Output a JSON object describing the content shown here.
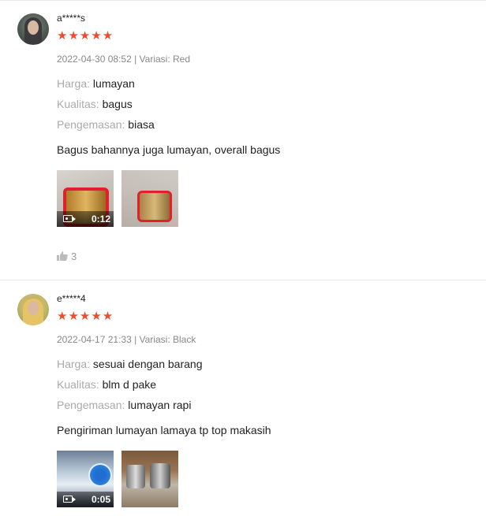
{
  "reviews": [
    {
      "username": "a*****s",
      "stars": "★★★★★",
      "rating": 5,
      "meta": "2022-04-30 08:52 | Variasi: Red",
      "attributes": [
        {
          "label": "Harga:",
          "value": "lumayan"
        },
        {
          "label": "Kualitas:",
          "value": "bagus"
        },
        {
          "label": "Pengemasan:",
          "value": "biasa"
        }
      ],
      "comment": "Bagus bahannya juga lumayan, overall bagus",
      "media": [
        {
          "type": "video",
          "duration": "0:12"
        },
        {
          "type": "image"
        }
      ],
      "likes": "3"
    },
    {
      "username": "e*****4",
      "stars": "★★★★★",
      "rating": 5,
      "meta": "2022-04-17 21:33 | Variasi: Black",
      "attributes": [
        {
          "label": "Harga:",
          "value": "sesuai dengan barang"
        },
        {
          "label": "Kualitas:",
          "value": "blm d pake"
        },
        {
          "label": "Pengemasan:",
          "value": "lumayan rapi"
        }
      ],
      "comment": "Pengiriman lumayan lamaya tp top makasih",
      "media": [
        {
          "type": "video",
          "duration": "0:05"
        },
        {
          "type": "image"
        }
      ]
    }
  ],
  "colors": {
    "star": "#ee4d2d",
    "muted": "#888888",
    "label": "#aaaaaa",
    "text": "#222222"
  }
}
